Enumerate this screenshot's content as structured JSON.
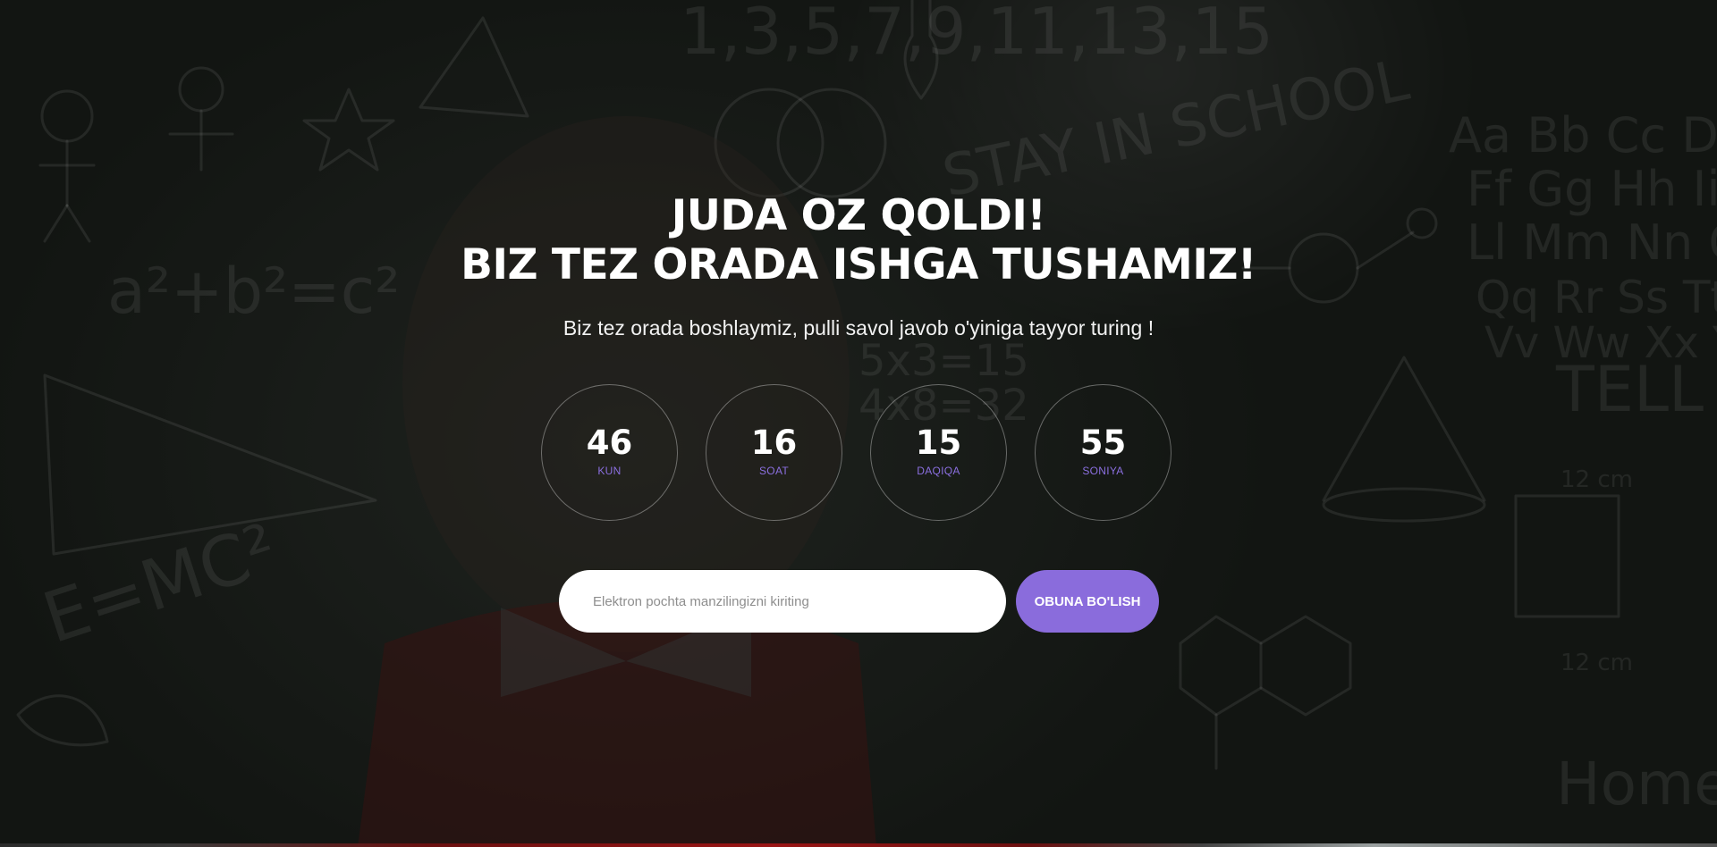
{
  "hero": {
    "headline_line1": "JUDA OZ QOLDI!",
    "headline_line2": "BIZ TEZ ORADA ISHGA TUSHAMIZ!",
    "subtitle": "Biz tez orada boshlaymiz, pulli savol javob o'yiniga tayyor turing !"
  },
  "countdown": [
    {
      "value": "46",
      "label": "KUN"
    },
    {
      "value": "16",
      "label": "SOAT"
    },
    {
      "value": "15",
      "label": "DAQIQA"
    },
    {
      "value": "55",
      "label": "SONIYA"
    }
  ],
  "subscribe": {
    "email_placeholder": "Elektron pochta manzilingizni kiriting",
    "button_label": "OBUNA BO'LISH"
  },
  "colors": {
    "accent": "#8a6cdc",
    "label": "#8b6fe0",
    "overlay": "#171a17"
  }
}
